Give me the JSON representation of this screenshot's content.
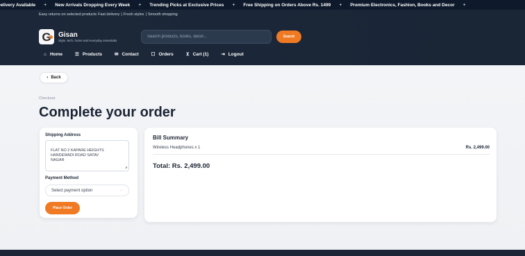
{
  "ticker": [
    "Delivery Available",
    "New Arrivals Dropping Every Week",
    "Trending Picks at Exclusive Prices",
    "Free Shipping on Orders Above Rs. 1499",
    "Premium Electronics, Fashion, Books and Decor"
  ],
  "ticker_sep": "+",
  "header": {
    "subbar": [
      "Easy returns on selected products",
      "Fast delivery",
      "Fresh styles",
      "Smooth shopping"
    ],
    "brand": {
      "logo_letter": "G",
      "name": "Gisan",
      "tagline": "Style, tech, home and everyday essentials"
    },
    "search": {
      "placeholder": "Search products, books, decor...",
      "button": "Search"
    },
    "nav": [
      {
        "icon": "home-icon",
        "glyph": "⌂",
        "label": "Home"
      },
      {
        "icon": "products-icon",
        "glyph": "☰",
        "label": "Products"
      },
      {
        "icon": "mail-icon",
        "glyph": "✉",
        "label": "Contact"
      },
      {
        "icon": "orders-icon",
        "glyph": "☐",
        "label": "Orders"
      },
      {
        "icon": "cart-icon",
        "glyph": "⊻",
        "label": "Cart (1)"
      },
      {
        "icon": "logout-icon",
        "glyph": "⇥",
        "label": "Logout"
      }
    ]
  },
  "main": {
    "back": "Back",
    "breadcrumb": "Checkout",
    "title": "Complete your order",
    "shipping": {
      "label": "Shipping Address",
      "address": "FLAT NO 2 KAPARE HEIGHTS\nHANDEWADI ROAD SATAV\nNAGAR"
    },
    "payment": {
      "label": "Payment Method",
      "selected": "Select payment option"
    },
    "place_order": "Place Order",
    "bill": {
      "title": "Bill Summary",
      "items": [
        {
          "name": "Wireless Headphones x 1",
          "amount": "Rs. 2,499.00"
        }
      ],
      "total": "Total: Rs. 2,499.00"
    }
  },
  "colors": {
    "accent": "#f07a23",
    "header": "#1c2839",
    "title": "#1c2535"
  }
}
